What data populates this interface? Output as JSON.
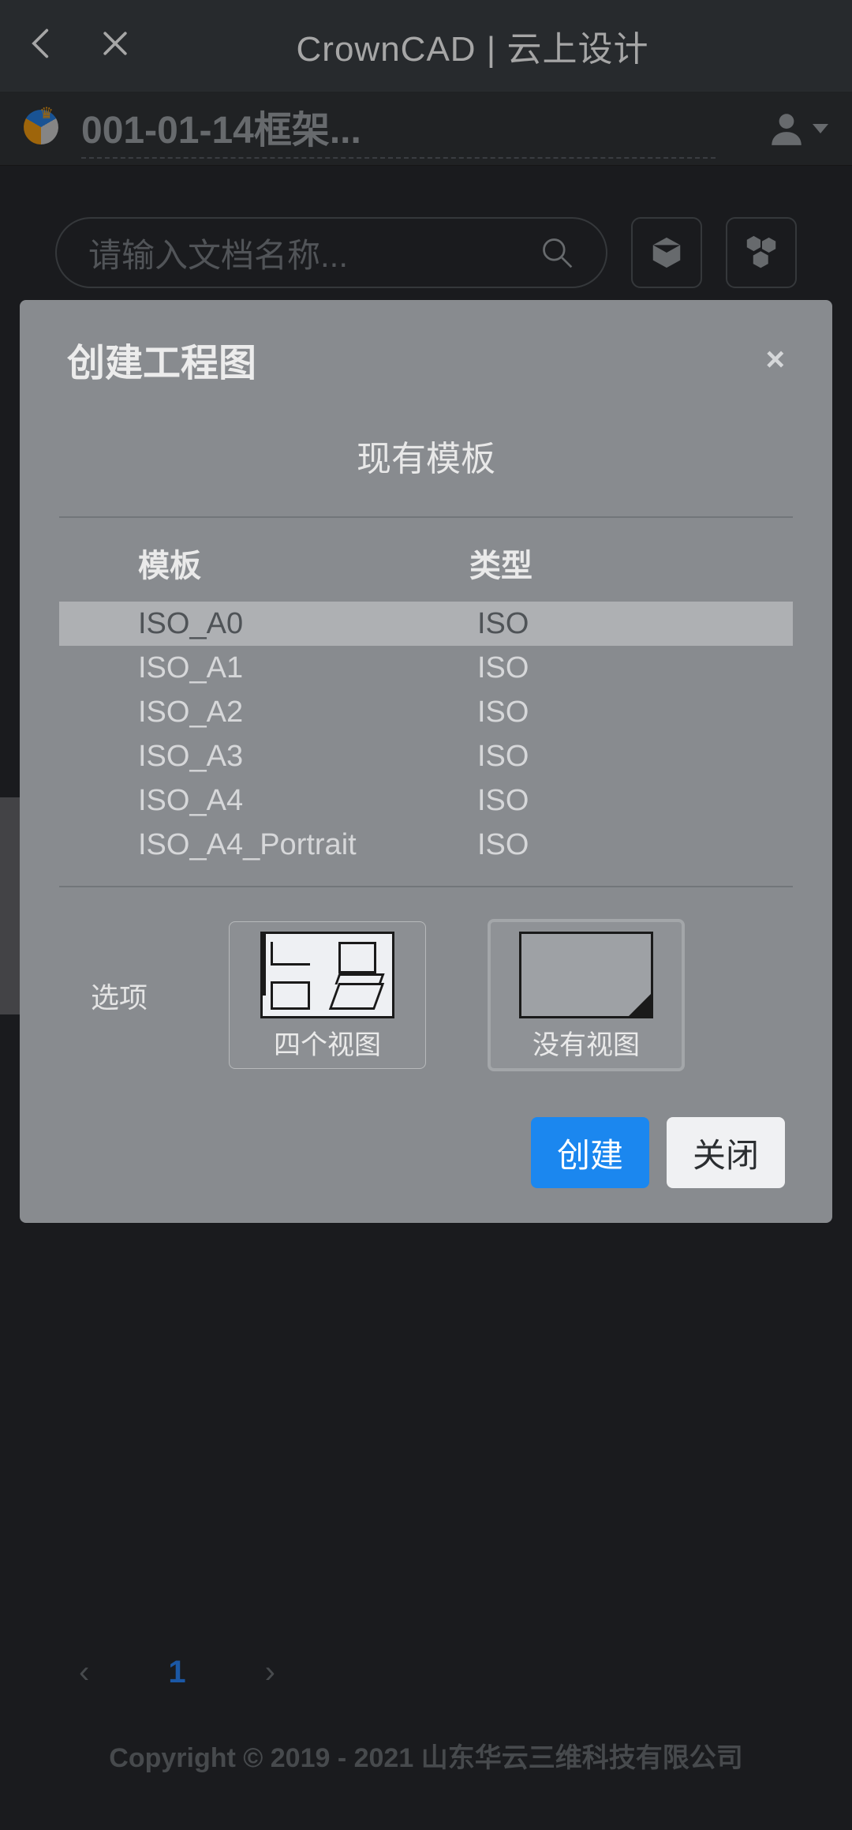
{
  "header": {
    "app_title": "CrownCAD | 云上设计"
  },
  "doc": {
    "name_truncated": "001-01-14框架..."
  },
  "search": {
    "placeholder": "请输入文档名称..."
  },
  "pager": {
    "current_page": "1"
  },
  "footer": {
    "copyright": "Copyright © 2019 - 2021 山东华云三维科技有限公司"
  },
  "modal": {
    "title": "创建工程图",
    "section_title": "现有模板",
    "table_headers": {
      "template": "模板",
      "type": "类型"
    },
    "templates": [
      {
        "name": "ISO_A0",
        "type": "ISO",
        "selected": true
      },
      {
        "name": "ISO_A1",
        "type": "ISO",
        "selected": false
      },
      {
        "name": "ISO_A2",
        "type": "ISO",
        "selected": false
      },
      {
        "name": "ISO_A3",
        "type": "ISO",
        "selected": false
      },
      {
        "name": "ISO_A4",
        "type": "ISO",
        "selected": false
      },
      {
        "name": "ISO_A4_Portrait",
        "type": "ISO",
        "selected": false
      }
    ],
    "options_label": "选项",
    "options": [
      {
        "caption": "四个视图",
        "selected": false
      },
      {
        "caption": "没有视图",
        "selected": true
      }
    ],
    "actions": {
      "create": "创建",
      "close": "关闭"
    }
  }
}
